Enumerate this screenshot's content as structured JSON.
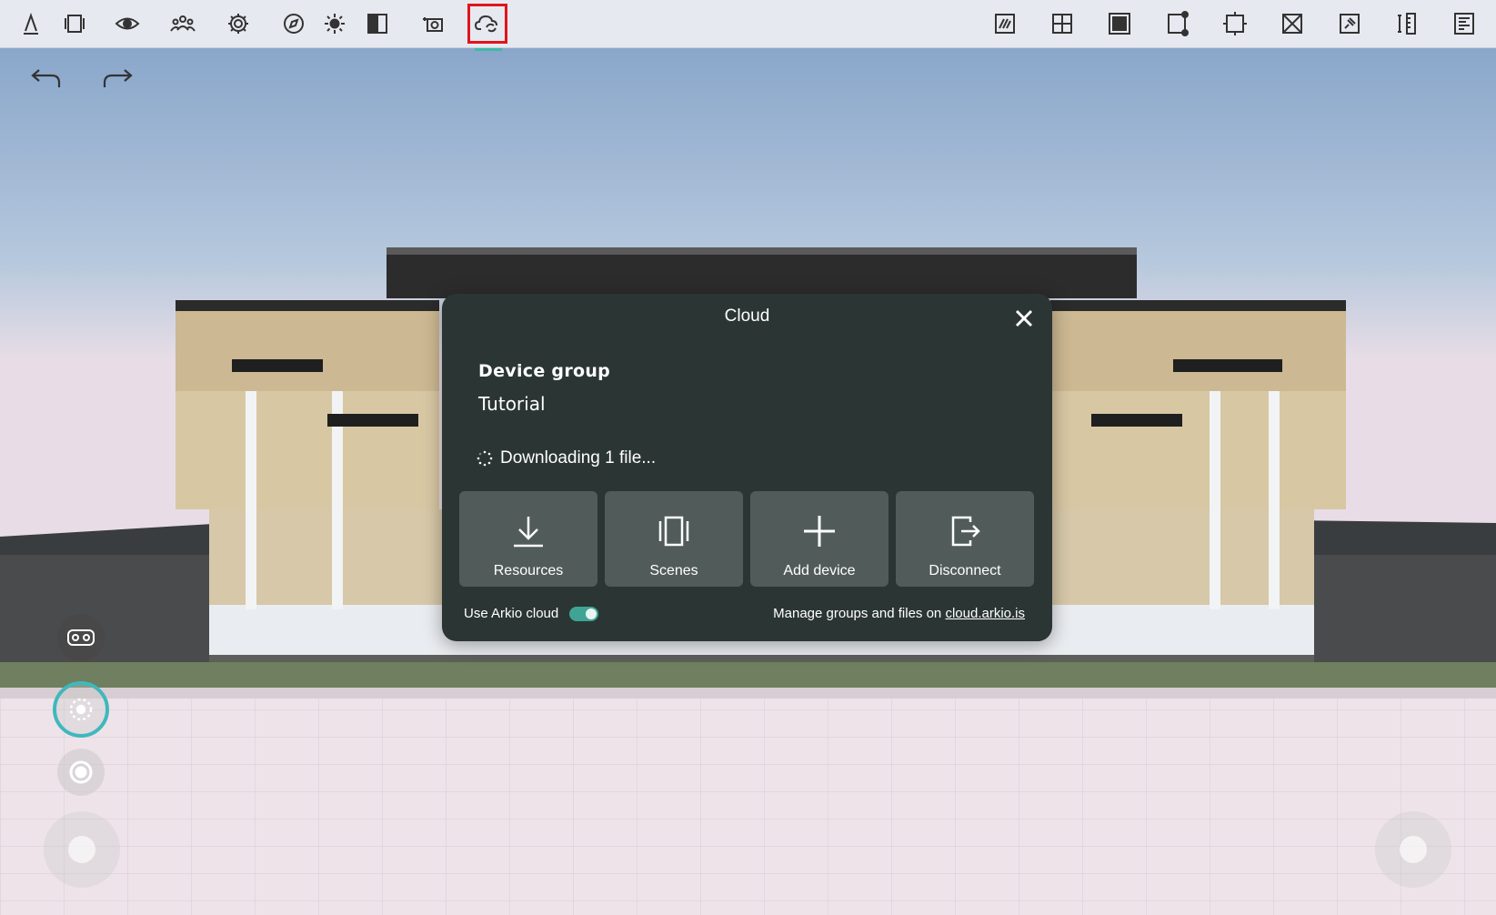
{
  "toolbar": {
    "left_icons": [
      "pencil-icon",
      "panel-frame-icon",
      "eye-icon",
      "people-icon",
      "gear-icon",
      "compass-icon",
      "sun-icon",
      "split-view-icon",
      "screenshot-icon",
      "cloud-sync-icon"
    ],
    "right_icons": [
      "sketch-icon",
      "grid-icon",
      "filled-square-icon",
      "resize-corner-icon",
      "select-frame-icon",
      "crossed-box-icon",
      "pin-box-icon",
      "ruler-icon",
      "document-icon"
    ],
    "active_icon": "cloud-sync-icon",
    "highlight_color": "#e0141c",
    "accent_color": "#3fb8a7"
  },
  "cloud_dialog": {
    "title": "Cloud",
    "device_group_heading": "Device group",
    "device_group_name": "Tutorial",
    "status_text": "Downloading 1 file...",
    "buttons": [
      {
        "label": "Resources",
        "icon": "download-icon"
      },
      {
        "label": "Scenes",
        "icon": "scenes-icon"
      },
      {
        "label": "Add device",
        "icon": "plus-icon"
      },
      {
        "label": "Disconnect",
        "icon": "exit-icon"
      }
    ],
    "use_cloud_label": "Use Arkio cloud",
    "use_cloud_enabled": true,
    "manage_text": "Manage groups and files on",
    "manage_link": "cloud.arkio.is",
    "background_color": "#2b3534"
  },
  "side_controls": [
    "vr-headset-icon",
    "orbit-icon",
    "target-icon",
    "joystick-left",
    "joystick-right"
  ]
}
